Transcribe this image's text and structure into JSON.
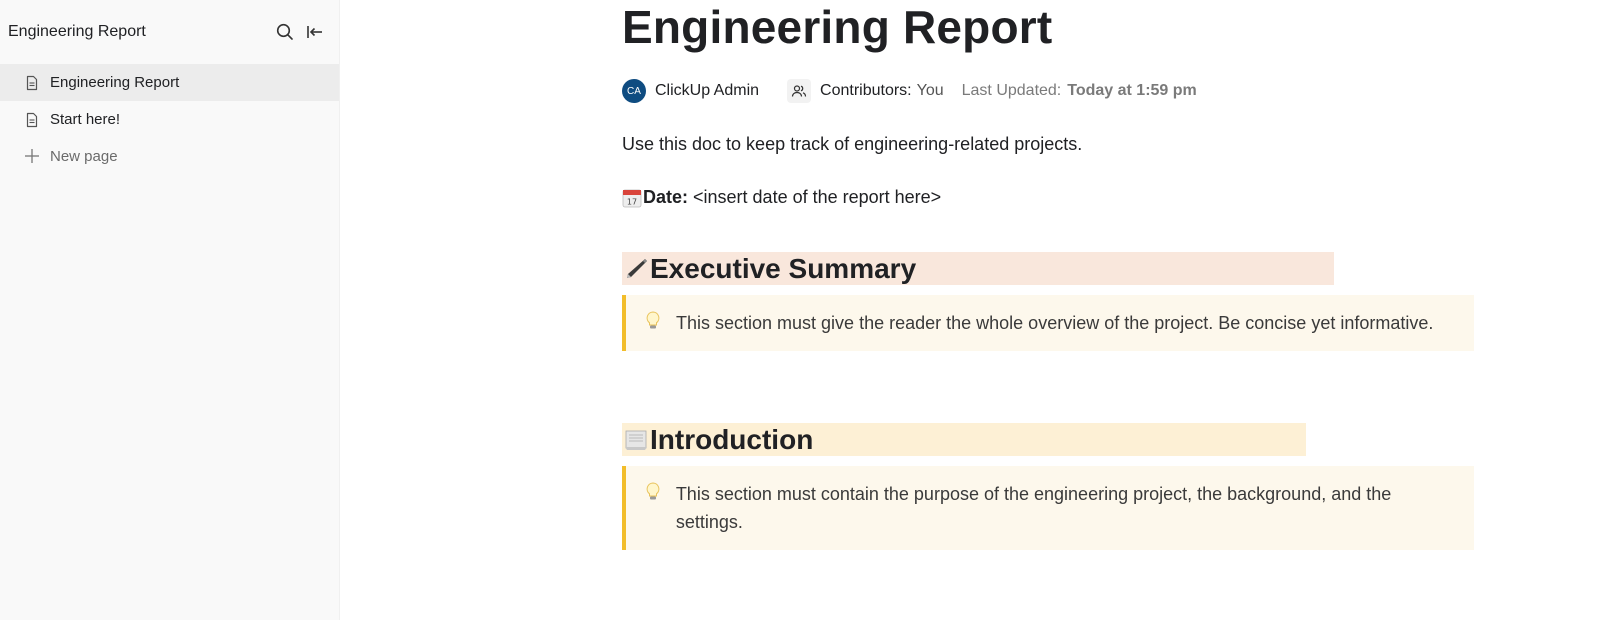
{
  "sidebar": {
    "title": "Engineering Report",
    "icons": {
      "search": "search-icon",
      "collapse": "collapse-sidebar-icon"
    },
    "items": [
      {
        "label": "Engineering Report",
        "icon": "document-icon",
        "active": true
      },
      {
        "label": "Start here!",
        "icon": "document-icon",
        "active": false
      }
    ],
    "new_page_label": "New page"
  },
  "doc": {
    "title": "Engineering Report",
    "meta": {
      "avatar_initials": "CA",
      "avatar_color": "#0f4c81",
      "author": "ClickUp Admin",
      "contributors_label": "Contributors:",
      "contributors_value": "You",
      "last_updated_label": "Last Updated:",
      "last_updated_value": "Today at 1:59 pm"
    },
    "intro": "Use this doc to keep track of engineering-related projects.",
    "date_label": "Date:",
    "date_value": "<insert date of the report here>",
    "sections": [
      {
        "heading": "Executive Summary",
        "emoji": "pen-icon",
        "highlight": "#f9e7dc",
        "callout": "This section must give the reader the whole overview of the project. Be concise yet informative."
      },
      {
        "heading": "Introduction",
        "emoji": "scroll-icon",
        "highlight": "#fdf0d5",
        "callout": "This section must contain the purpose of the engineering project, the background, and the settings."
      }
    ],
    "callout_accent": "#f2bd2a",
    "callout_bg": "#fdf8ec"
  }
}
